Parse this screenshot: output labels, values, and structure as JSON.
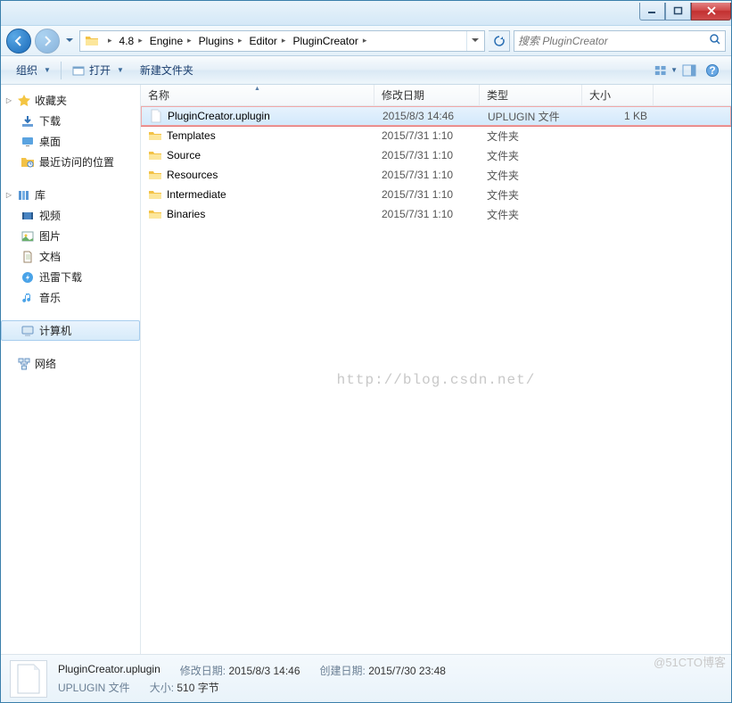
{
  "titlebar": {},
  "breadcrumbs": [
    "4.8",
    "Engine",
    "Plugins",
    "Editor",
    "PluginCreator"
  ],
  "search": {
    "placeholder": "搜索 PluginCreator"
  },
  "toolbar": {
    "organize": "组织",
    "open": "打开",
    "newfolder": "新建文件夹"
  },
  "columns": {
    "name": "名称",
    "date": "修改日期",
    "type": "类型",
    "size": "大小"
  },
  "nav": {
    "fav": {
      "head": "收藏夹",
      "items": [
        "下载",
        "桌面",
        "最近访问的位置"
      ]
    },
    "lib": {
      "head": "库",
      "items": [
        "视频",
        "图片",
        "文档",
        "迅雷下载",
        "音乐"
      ]
    },
    "pc": {
      "head": "计算机"
    },
    "net": {
      "head": "网络"
    }
  },
  "files": [
    {
      "name": "Binaries",
      "date": "2015/7/31 1:10",
      "type": "文件夹",
      "size": "",
      "icon": "folder"
    },
    {
      "name": "Intermediate",
      "date": "2015/7/31 1:10",
      "type": "文件夹",
      "size": "",
      "icon": "folder"
    },
    {
      "name": "Resources",
      "date": "2015/7/31 1:10",
      "type": "文件夹",
      "size": "",
      "icon": "folder"
    },
    {
      "name": "Source",
      "date": "2015/7/31 1:10",
      "type": "文件夹",
      "size": "",
      "icon": "folder"
    },
    {
      "name": "Templates",
      "date": "2015/7/31 1:10",
      "type": "文件夹",
      "size": "",
      "icon": "folder"
    },
    {
      "name": "PluginCreator.uplugin",
      "date": "2015/8/3 14:46",
      "type": "UPLUGIN 文件",
      "size": "1 KB",
      "icon": "file",
      "sel": true
    }
  ],
  "details": {
    "name": "PluginCreator.uplugin",
    "type": "UPLUGIN 文件",
    "mod_lbl": "修改日期:",
    "mod": "2015/8/3 14:46",
    "crt_lbl": "创建日期:",
    "crt": "2015/7/30 23:48",
    "size_lbl": "大小:",
    "size": "510 字节"
  },
  "watermark": "http://blog.csdn.net/",
  "corner": "@51CTO博客"
}
